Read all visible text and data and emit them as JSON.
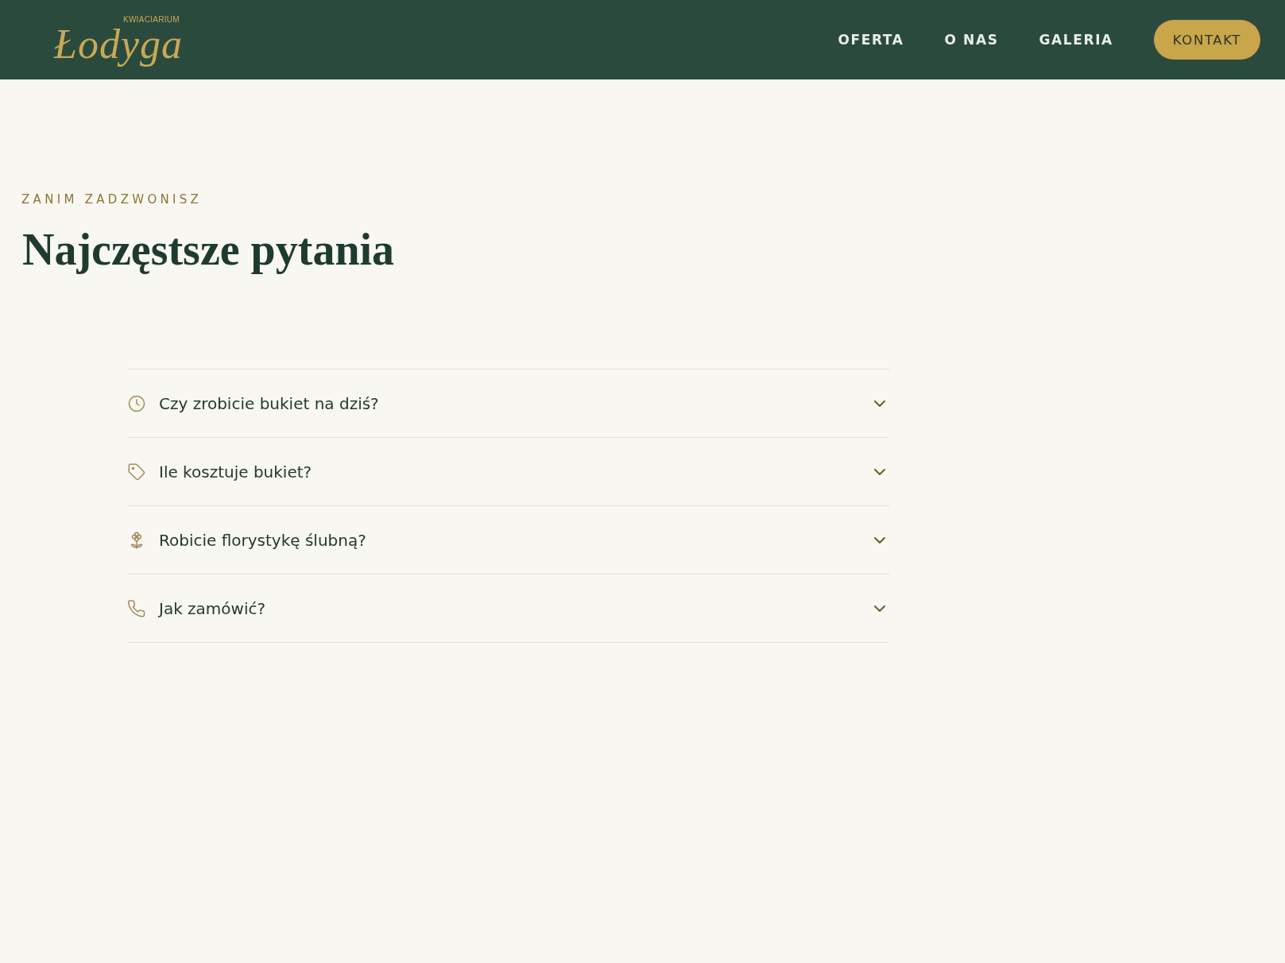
{
  "header": {
    "logo": {
      "tagline": "KWIACIARIUM",
      "wordmark": "Łodyga"
    },
    "nav": [
      {
        "label": "OFERTA"
      },
      {
        "label": "O NAS"
      },
      {
        "label": "GALERIA"
      }
    ],
    "cta": "KONTAKT"
  },
  "faq": {
    "eyebrow": "ZANIM ZADZWONISZ",
    "title": "Najczęstsze pytania",
    "items": [
      {
        "question": "Czy zrobicie bukiet na dziś?",
        "expanded": false
      },
      {
        "question": "Ile kosztuje bukiet?",
        "expanded": false
      },
      {
        "question": "Robicie florystykę ślubną?",
        "expanded": false
      },
      {
        "question": "Jak zamówić?",
        "expanded": false
      }
    ]
  }
}
